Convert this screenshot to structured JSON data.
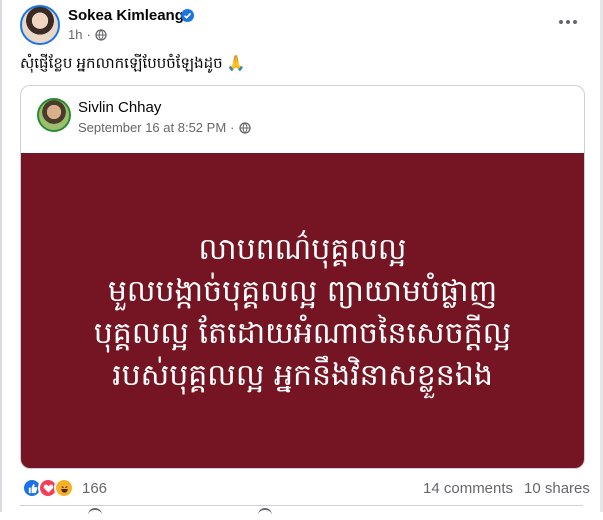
{
  "post": {
    "author": "Sokea Kimleang",
    "time": "1h",
    "caption": "សុំផ្ញើខ្លែប អ្នកលាកឡើបែបចំឡែងដូច 🙏"
  },
  "shared_post": {
    "author": "Sivlin Chhay",
    "date": "September 16 at 8:52 PM",
    "quote_lines": [
      "លាបពណ៌បុគ្គលល្អ",
      "មួលបង្កាច់បុគ្គលល្អ ព្យាយាមបំផ្លាញ",
      "បុគ្គលល្អ តែដោយអំណាចនៃសេចក្តីល្អ",
      "របស់បុគ្គលល្អ អ្នកនឹងវិនាសខ្លួនឯង"
    ]
  },
  "stats": {
    "reactions": "166",
    "comments": "14 comments",
    "shares": "10 shares"
  },
  "colors": {
    "quote_background": "#751422",
    "like_blue": "#1b74e4",
    "love_red": "#f33e58",
    "haha_yellow": "#f7b125"
  },
  "icons": [
    "verified-icon",
    "globe-icon",
    "more-icon",
    "like-icon",
    "love-icon",
    "haha-icon"
  ]
}
